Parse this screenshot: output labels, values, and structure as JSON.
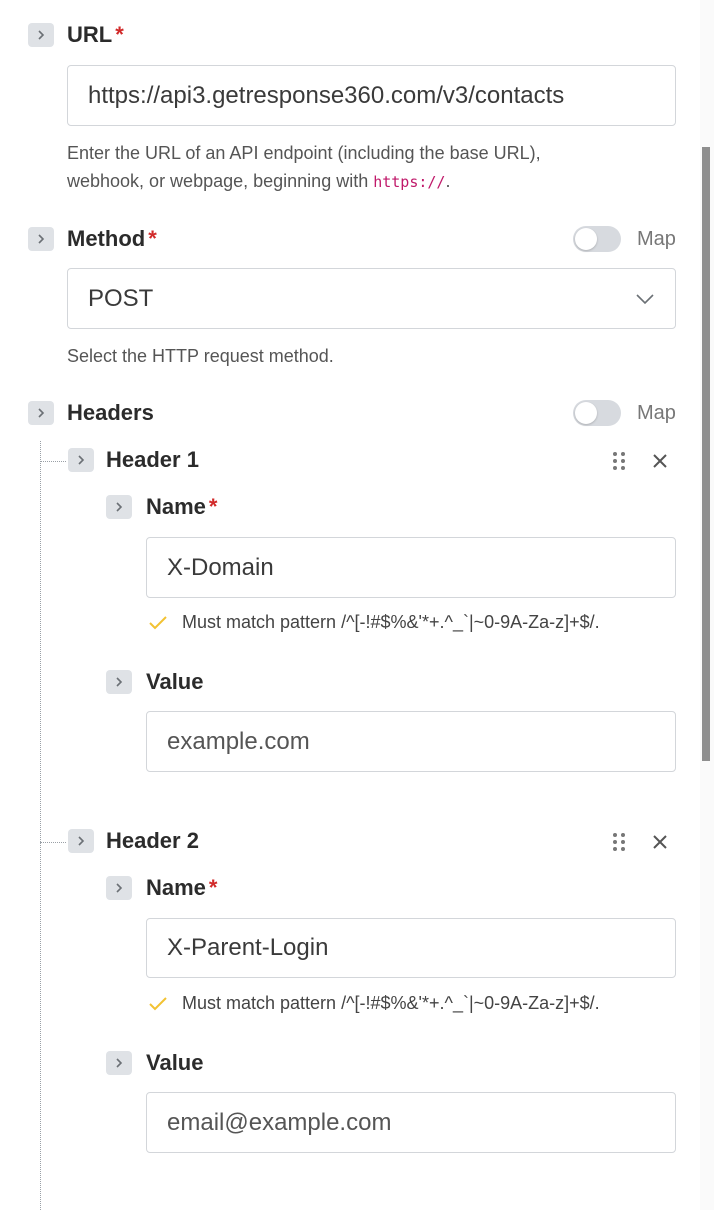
{
  "url": {
    "label": "URL",
    "required": "*",
    "value": "https://api3.getresponse360.com/v3/contacts",
    "help_text": "Enter the URL of an API endpoint (including the base URL),",
    "help_text_2": "webhook, or webpage, beginning with ",
    "help_code": "https://",
    "help_end": "."
  },
  "method": {
    "label": "Method",
    "required": "*",
    "map_label": "Map",
    "value": "POST",
    "help_text": "Select the HTTP request method."
  },
  "headers": {
    "label": "Headers",
    "map_label": "Map",
    "items": [
      {
        "title": "Header 1",
        "name_label": "Name",
        "name_required": "*",
        "name_value": "X-Domain",
        "pattern": "Must match pattern /^[-!#$%&'*+.^_`|~0-9A-Za-z]+$/.",
        "value_label": "Value",
        "value_placeholder": "example.com"
      },
      {
        "title": "Header 2",
        "name_label": "Name",
        "name_required": "*",
        "name_value": "X-Parent-Login",
        "pattern": "Must match pattern /^[-!#$%&'*+.^_`|~0-9A-Za-z]+$/.",
        "value_label": "Value",
        "value_placeholder": "email@example.com"
      }
    ]
  },
  "colors": {
    "required": "#d12a2a",
    "check": "#f2c232",
    "code": "#c0196a",
    "toggle_off": "#d7dadf"
  },
  "icons": [
    "chevron-right-icon",
    "chevron-down-icon",
    "drag-handle-icon",
    "close-icon",
    "checkmark-icon"
  ]
}
